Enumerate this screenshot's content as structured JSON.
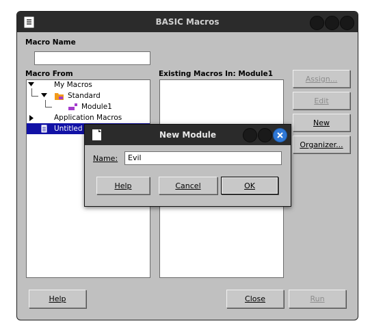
{
  "window": {
    "title": "BASIC Macros"
  },
  "labels": {
    "macro_name": "Macro Name",
    "macro_from": "Macro From",
    "existing_macros": "Existing Macros In: Module1"
  },
  "macro_name_value": "",
  "tree": [
    {
      "label": "My Macros"
    },
    {
      "label": "Standard"
    },
    {
      "label": "Module1"
    },
    {
      "label": "Application Macros"
    },
    {
      "label": "Untitled 1"
    }
  ],
  "buttons": {
    "assign": "Assign...",
    "edit": "Edit",
    "new": "New",
    "organizer": "Organizer...",
    "help": "Help",
    "close": "Close",
    "run": "Run"
  },
  "dialog": {
    "title": "New Module",
    "name_label": "Name:",
    "name_value": "Evil",
    "help": "Help",
    "cancel": "Cancel",
    "ok": "OK"
  },
  "colors": {
    "selection": "#1212a6",
    "accent_close": "#2f78d6"
  }
}
